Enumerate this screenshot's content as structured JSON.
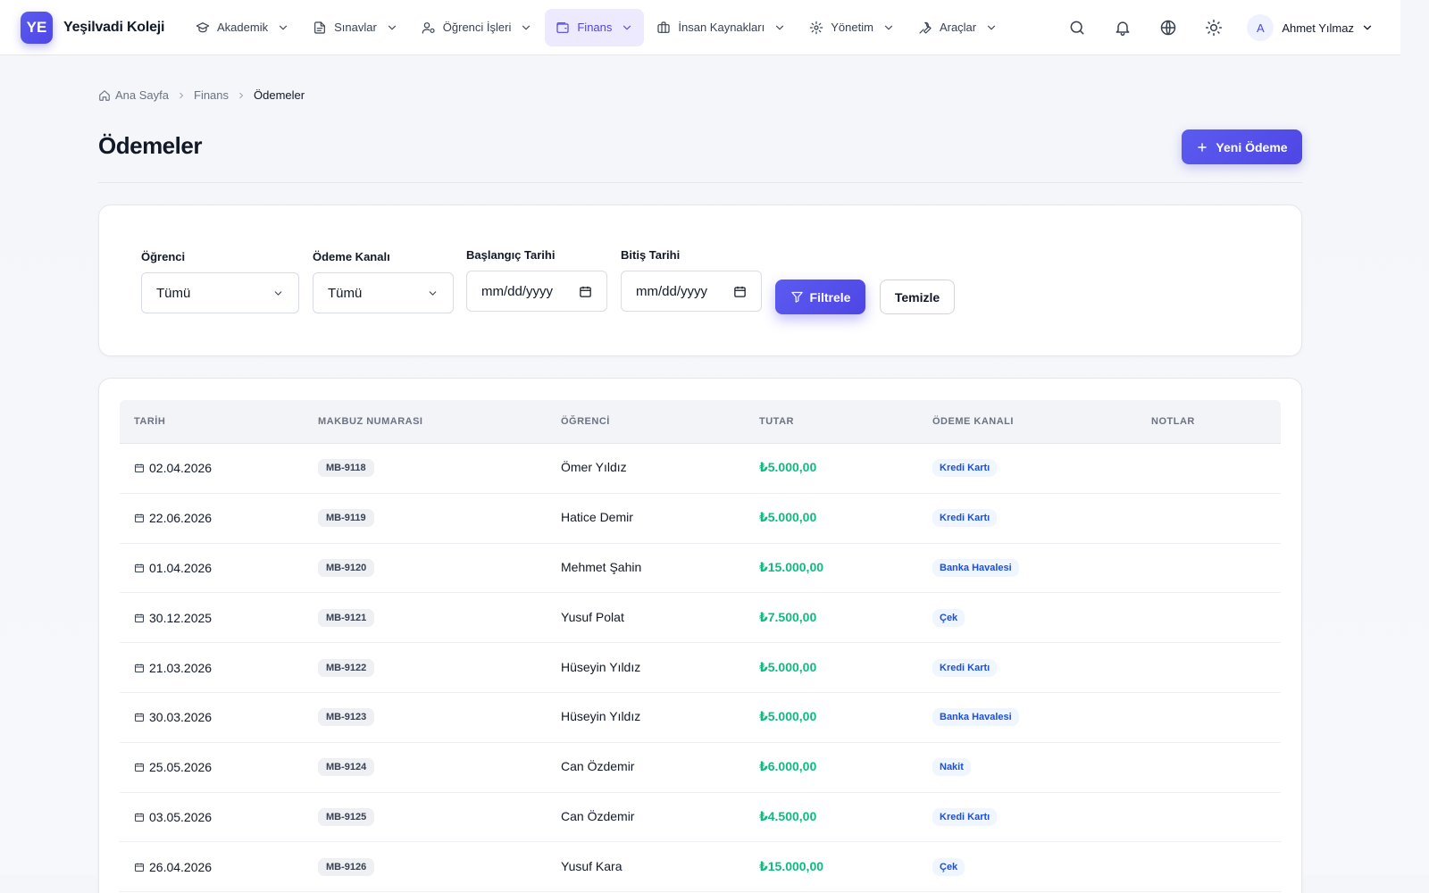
{
  "brand": {
    "logo_text": "YE",
    "name": "Yeşilvadi Koleji"
  },
  "nav": [
    {
      "label": "Akademik",
      "icon": "graduation-cap-icon",
      "active": false
    },
    {
      "label": "Sınavlar",
      "icon": "document-icon",
      "active": false
    },
    {
      "label": "Öğrenci İşleri",
      "icon": "users-gear-icon",
      "active": false
    },
    {
      "label": "Finans",
      "icon": "wallet-icon",
      "active": true
    },
    {
      "label": "İnsan Kaynakları",
      "icon": "briefcase-icon",
      "active": false
    },
    {
      "label": "Yönetim",
      "icon": "gear-icon",
      "active": false
    },
    {
      "label": "Araçlar",
      "icon": "wrench-icon",
      "active": false
    }
  ],
  "user": {
    "initial": "A",
    "name": "Ahmet Yılmaz"
  },
  "breadcrumb": {
    "home": "Ana Sayfa",
    "section": "Finans",
    "current": "Ödemeler"
  },
  "page": {
    "title": "Ödemeler",
    "new_button": "Yeni Ödeme"
  },
  "filters": {
    "student_label": "Öğrenci",
    "student_value": "Tümü",
    "channel_label": "Ödeme Kanalı",
    "channel_value": "Tümü",
    "start_label": "Başlangıç Tarihi",
    "start_value": "mm/dd/yyyy",
    "end_label": "Bitiş Tarihi",
    "end_value": "mm/dd/yyyy",
    "filter_button": "Filtrele",
    "clear_button": "Temizle"
  },
  "table": {
    "headers": [
      "TARİH",
      "MAKBUZ NUMARASI",
      "ÖĞRENCİ",
      "TUTAR",
      "ÖDEME KANALI",
      "NOTLAR"
    ],
    "rows": [
      {
        "date": "02.04.2026",
        "receipt": "MB-9118",
        "student": "Ömer Yıldız",
        "amount": "₺5.000,00",
        "channel": "Kredi Kartı",
        "notes": ""
      },
      {
        "date": "22.06.2026",
        "receipt": "MB-9119",
        "student": "Hatice Demir",
        "amount": "₺5.000,00",
        "channel": "Kredi Kartı",
        "notes": ""
      },
      {
        "date": "01.04.2026",
        "receipt": "MB-9120",
        "student": "Mehmet Şahin",
        "amount": "₺15.000,00",
        "channel": "Banka Havalesi",
        "notes": ""
      },
      {
        "date": "30.12.2025",
        "receipt": "MB-9121",
        "student": "Yusuf Polat",
        "amount": "₺7.500,00",
        "channel": "Çek",
        "notes": ""
      },
      {
        "date": "21.03.2026",
        "receipt": "MB-9122",
        "student": "Hüseyin Yıldız",
        "amount": "₺5.000,00",
        "channel": "Kredi Kartı",
        "notes": ""
      },
      {
        "date": "30.03.2026",
        "receipt": "MB-9123",
        "student": "Hüseyin Yıldız",
        "amount": "₺5.000,00",
        "channel": "Banka Havalesi",
        "notes": ""
      },
      {
        "date": "25.05.2026",
        "receipt": "MB-9124",
        "student": "Can Özdemir",
        "amount": "₺6.000,00",
        "channel": "Nakit",
        "notes": ""
      },
      {
        "date": "03.05.2026",
        "receipt": "MB-9125",
        "student": "Can Özdemir",
        "amount": "₺4.500,00",
        "channel": "Kredi Kartı",
        "notes": ""
      },
      {
        "date": "26.04.2026",
        "receipt": "MB-9126",
        "student": "Yusuf Kara",
        "amount": "₺15.000,00",
        "channel": "Çek",
        "notes": ""
      }
    ]
  },
  "colors": {
    "accent": "#4f46e5",
    "amount": "#10b981",
    "channel_text": "#1d4ed8"
  }
}
